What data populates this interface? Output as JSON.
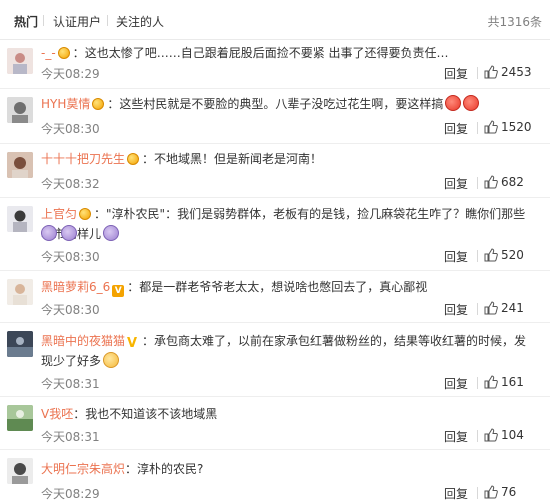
{
  "tabs": {
    "hot": "热门",
    "verified": "认证用户",
    "following": "关注的人",
    "total": "共1316条"
  },
  "actions": {
    "reply": "回复"
  },
  "comments": [
    {
      "user": "-_-",
      "text": "这也太惨了吧……自己跟着屁股后面捡不要紧 出事了还得要负责任…",
      "time": "今天08:29",
      "likes": "2453"
    },
    {
      "user": "HYH莫情",
      "text": "这些村民就是不要脸的典型。八辈子没吃过花生啊，要这样搞",
      "time": "今天08:30",
      "likes": "1520"
    },
    {
      "user": "十十十把刀先生",
      "text": "不地域黑！但是新闻老是河南！",
      "time": "今天08:32",
      "likes": "682"
    },
    {
      "user": "上官匀",
      "text": "\"淳朴农民\"：我们是弱势群体，老板有的是钱，捡几麻袋花生咋了？瞧你们那些小市民样儿",
      "time": "今天08:30",
      "likes": "520"
    },
    {
      "user": "黑暗萝莉6_6",
      "text": "都是一群老爷爷老太太，想说啥也憋回去了，真心鄙视",
      "time": "今天08:30",
      "likes": "241"
    },
    {
      "user": "黑暗中的夜猫猫",
      "text": "承包商太难了，以前在家承包红薯做粉丝的，结果等收红薯的时候，发现少了好多",
      "time": "今天08:31",
      "likes": "161"
    },
    {
      "user": "V我呸",
      "text": "我也不知道该不该地域黑",
      "time": "今天08:31",
      "likes": "104"
    },
    {
      "user": "大明仁宗朱高炽",
      "text": "淳朴的农民?",
      "time": "今天08:29",
      "likes": "76"
    }
  ]
}
